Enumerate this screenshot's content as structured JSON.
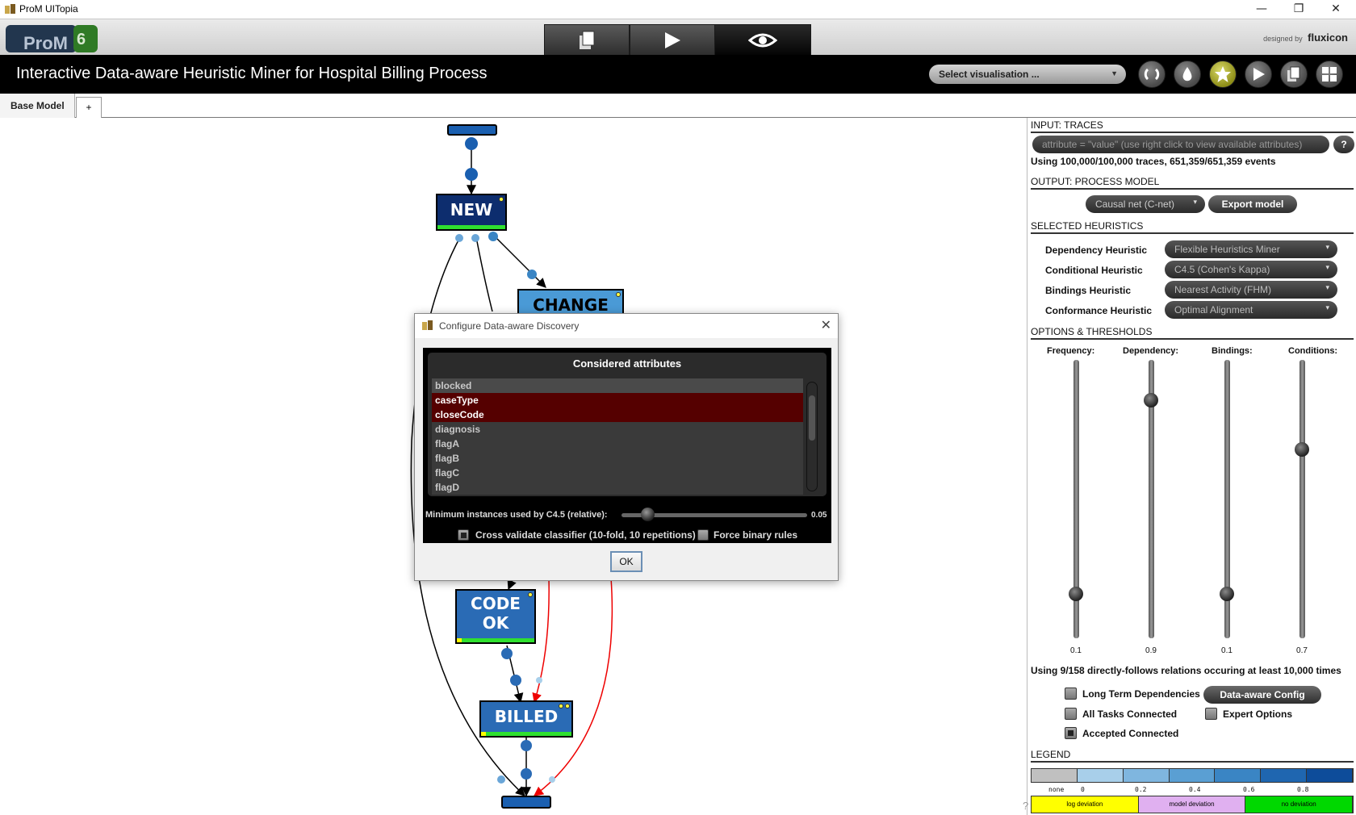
{
  "window": {
    "title": "ProM UITopia",
    "controls": [
      "—",
      "❐",
      "✕"
    ]
  },
  "header": {
    "logo_text": "ProM",
    "logo_version": "6",
    "designed_by": "designed by",
    "designer_brand": "fluxicon",
    "top_tabs": [
      "workspace",
      "actions",
      "views"
    ],
    "active_tab": "views"
  },
  "view": {
    "title": "Interactive Data-aware Heuristic Miner for Hospital Billing Process",
    "vis_select": "Select visualisation ...",
    "buttons": [
      "refresh",
      "drop",
      "favorite",
      "play",
      "copy",
      "grid"
    ]
  },
  "tabs": {
    "items": [
      "Base Model"
    ],
    "add_label": "+"
  },
  "graph": {
    "nodes": [
      {
        "id": "start",
        "label": "",
        "color": "#1a5fb0"
      },
      {
        "id": "new",
        "label": "NEW",
        "color": "#0d2d6e"
      },
      {
        "id": "change",
        "label": "CHANGE",
        "color": "#4a9ad6"
      },
      {
        "id": "codeok",
        "label": "CODE OK",
        "lines": [
          "CODE",
          "OK"
        ],
        "color": "#2a6bb5"
      },
      {
        "id": "billed",
        "label": "BILLED",
        "color": "#2a6bb5"
      },
      {
        "id": "end",
        "label": "",
        "color": "#1a5fb0"
      }
    ]
  },
  "panel": {
    "input_title": "INPUT: TRACES",
    "filter_placeholder": "attribute = \"value\" (use right click to view available attributes)",
    "help_label": "?",
    "traces_text": "Using 100,000/100,000 traces, 651,359/651,359 events",
    "output_title": "OUTPUT: PROCESS MODEL",
    "model_type": "Causal net (C-net)",
    "export_label": "Export model",
    "heuristics_title": "SELECTED HEURISTICS",
    "heuristics": [
      {
        "label": "Dependency Heuristic",
        "value": "Flexible Heuristics Miner"
      },
      {
        "label": "Conditional Heuristic",
        "value": "C4.5 (Cohen's Kappa)"
      },
      {
        "label": "Bindings Heuristic",
        "value": "Nearest Activity (FHM)"
      },
      {
        "label": "Conformance Heuristic",
        "value": "Optimal Alignment"
      }
    ],
    "options_title": "OPTIONS & THRESHOLDS",
    "sliders": [
      {
        "label": "Frequency:",
        "value": 0.1,
        "display": "0.1"
      },
      {
        "label": "Dependency:",
        "value": 0.9,
        "display": "0.9"
      },
      {
        "label": "Bindings:",
        "value": 0.1,
        "display": "0.1"
      },
      {
        "label": "Conditions:",
        "value": 0.7,
        "display": "0.7"
      }
    ],
    "relations_text": "Using 9/158 directly-follows relations occuring at least 10,000 times",
    "options": {
      "long_term": {
        "label": "Long Term Dependencies",
        "checked": false
      },
      "config_label": "Data-aware Config",
      "all_tasks": {
        "label": "All Tasks Connected",
        "checked": false
      },
      "expert": {
        "label": "Expert Options",
        "checked": false
      },
      "accepted": {
        "label": "Accepted Connected",
        "checked": true
      }
    },
    "legend_title": "LEGEND",
    "legend_scale": {
      "colors": [
        "#c0c0c0",
        "#a8cfea",
        "#7fb6df",
        "#5a9fd3",
        "#3a85c4",
        "#1f66b0",
        "#0d4c9a"
      ],
      "ticks": [
        "none",
        "0",
        "0.2",
        "0.4",
        "0.6",
        "0.8"
      ]
    },
    "legend_dev": [
      {
        "label": "log deviation",
        "color": "#ffff00"
      },
      {
        "label": "model deviation",
        "color": "#e0b0f0"
      },
      {
        "label": "no deviation",
        "color": "#00d800"
      }
    ],
    "corner_help": "?"
  },
  "dialog": {
    "title": "Configure Data-aware Discovery",
    "close": "✕",
    "list_title": "Considered attributes",
    "attributes": [
      {
        "name": "blocked",
        "selected": false
      },
      {
        "name": "caseType",
        "selected": true
      },
      {
        "name": "closeCode",
        "selected": true
      },
      {
        "name": "diagnosis",
        "selected": false
      },
      {
        "name": "flagA",
        "selected": false
      },
      {
        "name": "flagB",
        "selected": false
      },
      {
        "name": "flagC",
        "selected": false
      },
      {
        "name": "flagD",
        "selected": false
      }
    ],
    "min_label": "Minimum instances used by C4.5 (relative):",
    "min_value": 0.05,
    "min_display": "0.05",
    "cross_validate": {
      "label": "Cross validate classifier (10-fold, 10 repetitions)",
      "checked": true
    },
    "force_binary": {
      "label": "Force binary rules",
      "checked": false
    },
    "ok_label": "OK"
  }
}
